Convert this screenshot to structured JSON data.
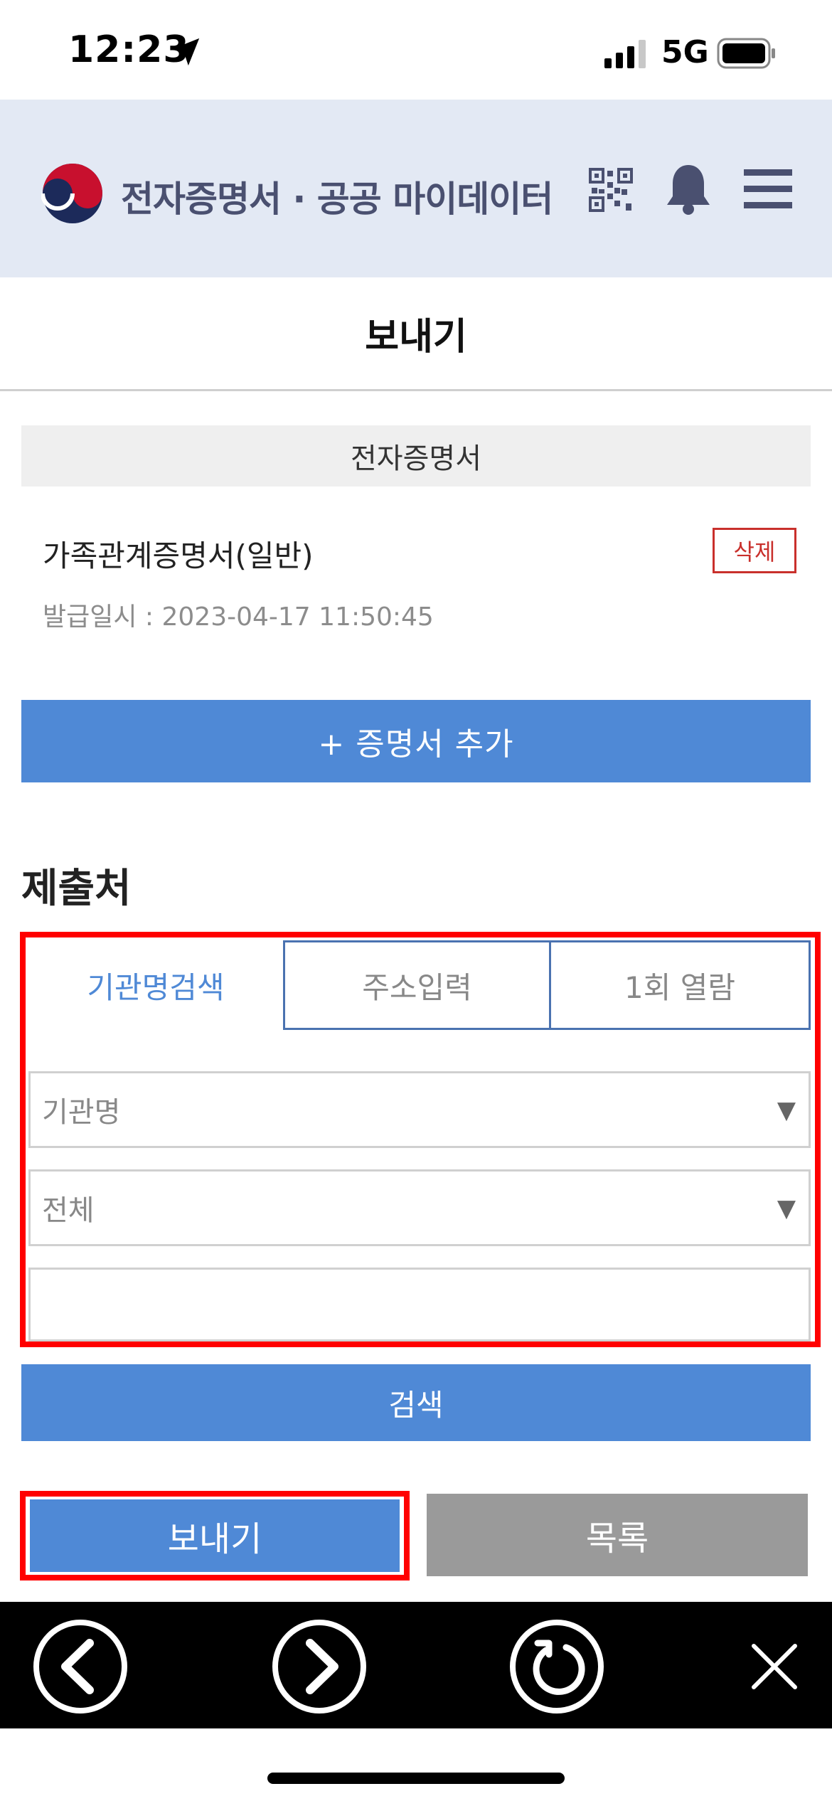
{
  "status_bar": {
    "time": "12:23",
    "network": "5G"
  },
  "header": {
    "title": "전자증명서 · 공공 마이데이터",
    "icons": [
      "qr-code-icon",
      "bell-icon",
      "menu-icon"
    ]
  },
  "page": {
    "title": "보내기"
  },
  "certificate": {
    "section_label": "전자증명서",
    "name": "가족관계증명서(일반)",
    "delete_label": "삭제",
    "issued_date": "발급일시 : 2023-04-17 11:50:45"
  },
  "add_cert_label": "+ 증명서 추가",
  "recipient": {
    "heading": "제출처",
    "tabs": [
      {
        "label": "기관명검색",
        "active": true
      },
      {
        "label": "주소입력",
        "active": false
      },
      {
        "label": "1회 열람",
        "active": false
      }
    ],
    "org_type_select": "기관명",
    "region_select": "전체",
    "keyword_value": "",
    "search_label": "검색"
  },
  "actions": {
    "send_label": "보내기",
    "list_label": "목록"
  },
  "colors": {
    "primary": "#4f89d6",
    "header_bg": "#e3e9f4",
    "highlight": "#ff0000",
    "danger": "#c9302c",
    "secondary": "#9a9a9a"
  }
}
